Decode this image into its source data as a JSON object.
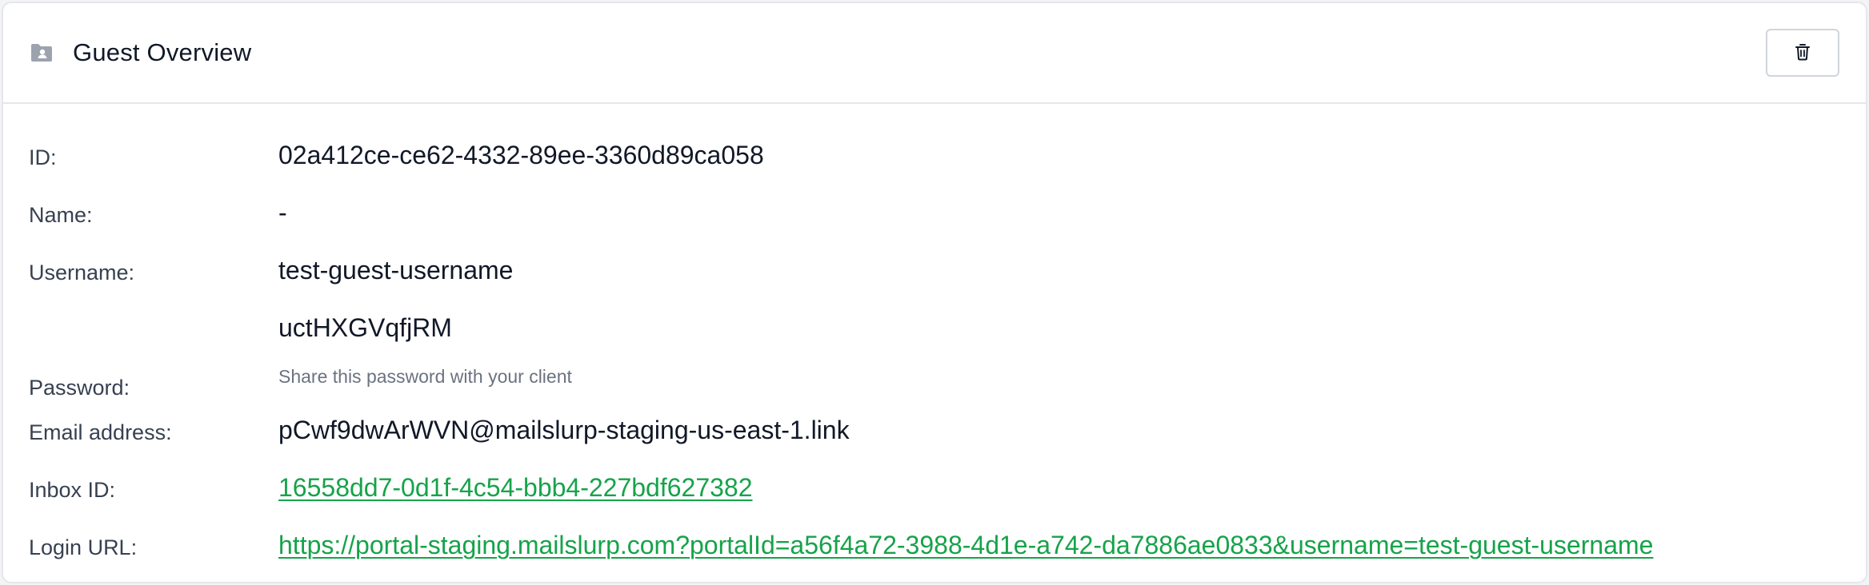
{
  "header": {
    "icon": "folder-user-icon",
    "title": "Guest Overview",
    "delete_icon": "trash-icon"
  },
  "fields": {
    "id": {
      "label": "ID:",
      "value": "02a412ce-ce62-4332-89ee-3360d89ca058"
    },
    "name": {
      "label": "Name:",
      "value": "-"
    },
    "username": {
      "label": "Username:",
      "value": "test-guest-username"
    },
    "password": {
      "label": "Password:",
      "value": "uctHXGVqfjRM",
      "hint": "Share this password with your client"
    },
    "email": {
      "label": "Email address:",
      "value": "pCwf9dwArWVN@mailslurp-staging-us-east-1.link"
    },
    "inbox_id": {
      "label": "Inbox ID:",
      "value": "16558dd7-0d1f-4c54-bbb4-227bdf627382"
    },
    "login_url": {
      "label": "Login URL:",
      "value": "https://portal-staging.mailslurp.com?portalId=a56f4a72-3988-4d1e-a742-da7886ae0833&username=test-guest-username"
    }
  },
  "colors": {
    "link": "#16a34a",
    "label": "#374151",
    "value": "#111827",
    "hint": "#6b7280",
    "border": "#e5e7eb",
    "icon": "#9ca3af"
  }
}
